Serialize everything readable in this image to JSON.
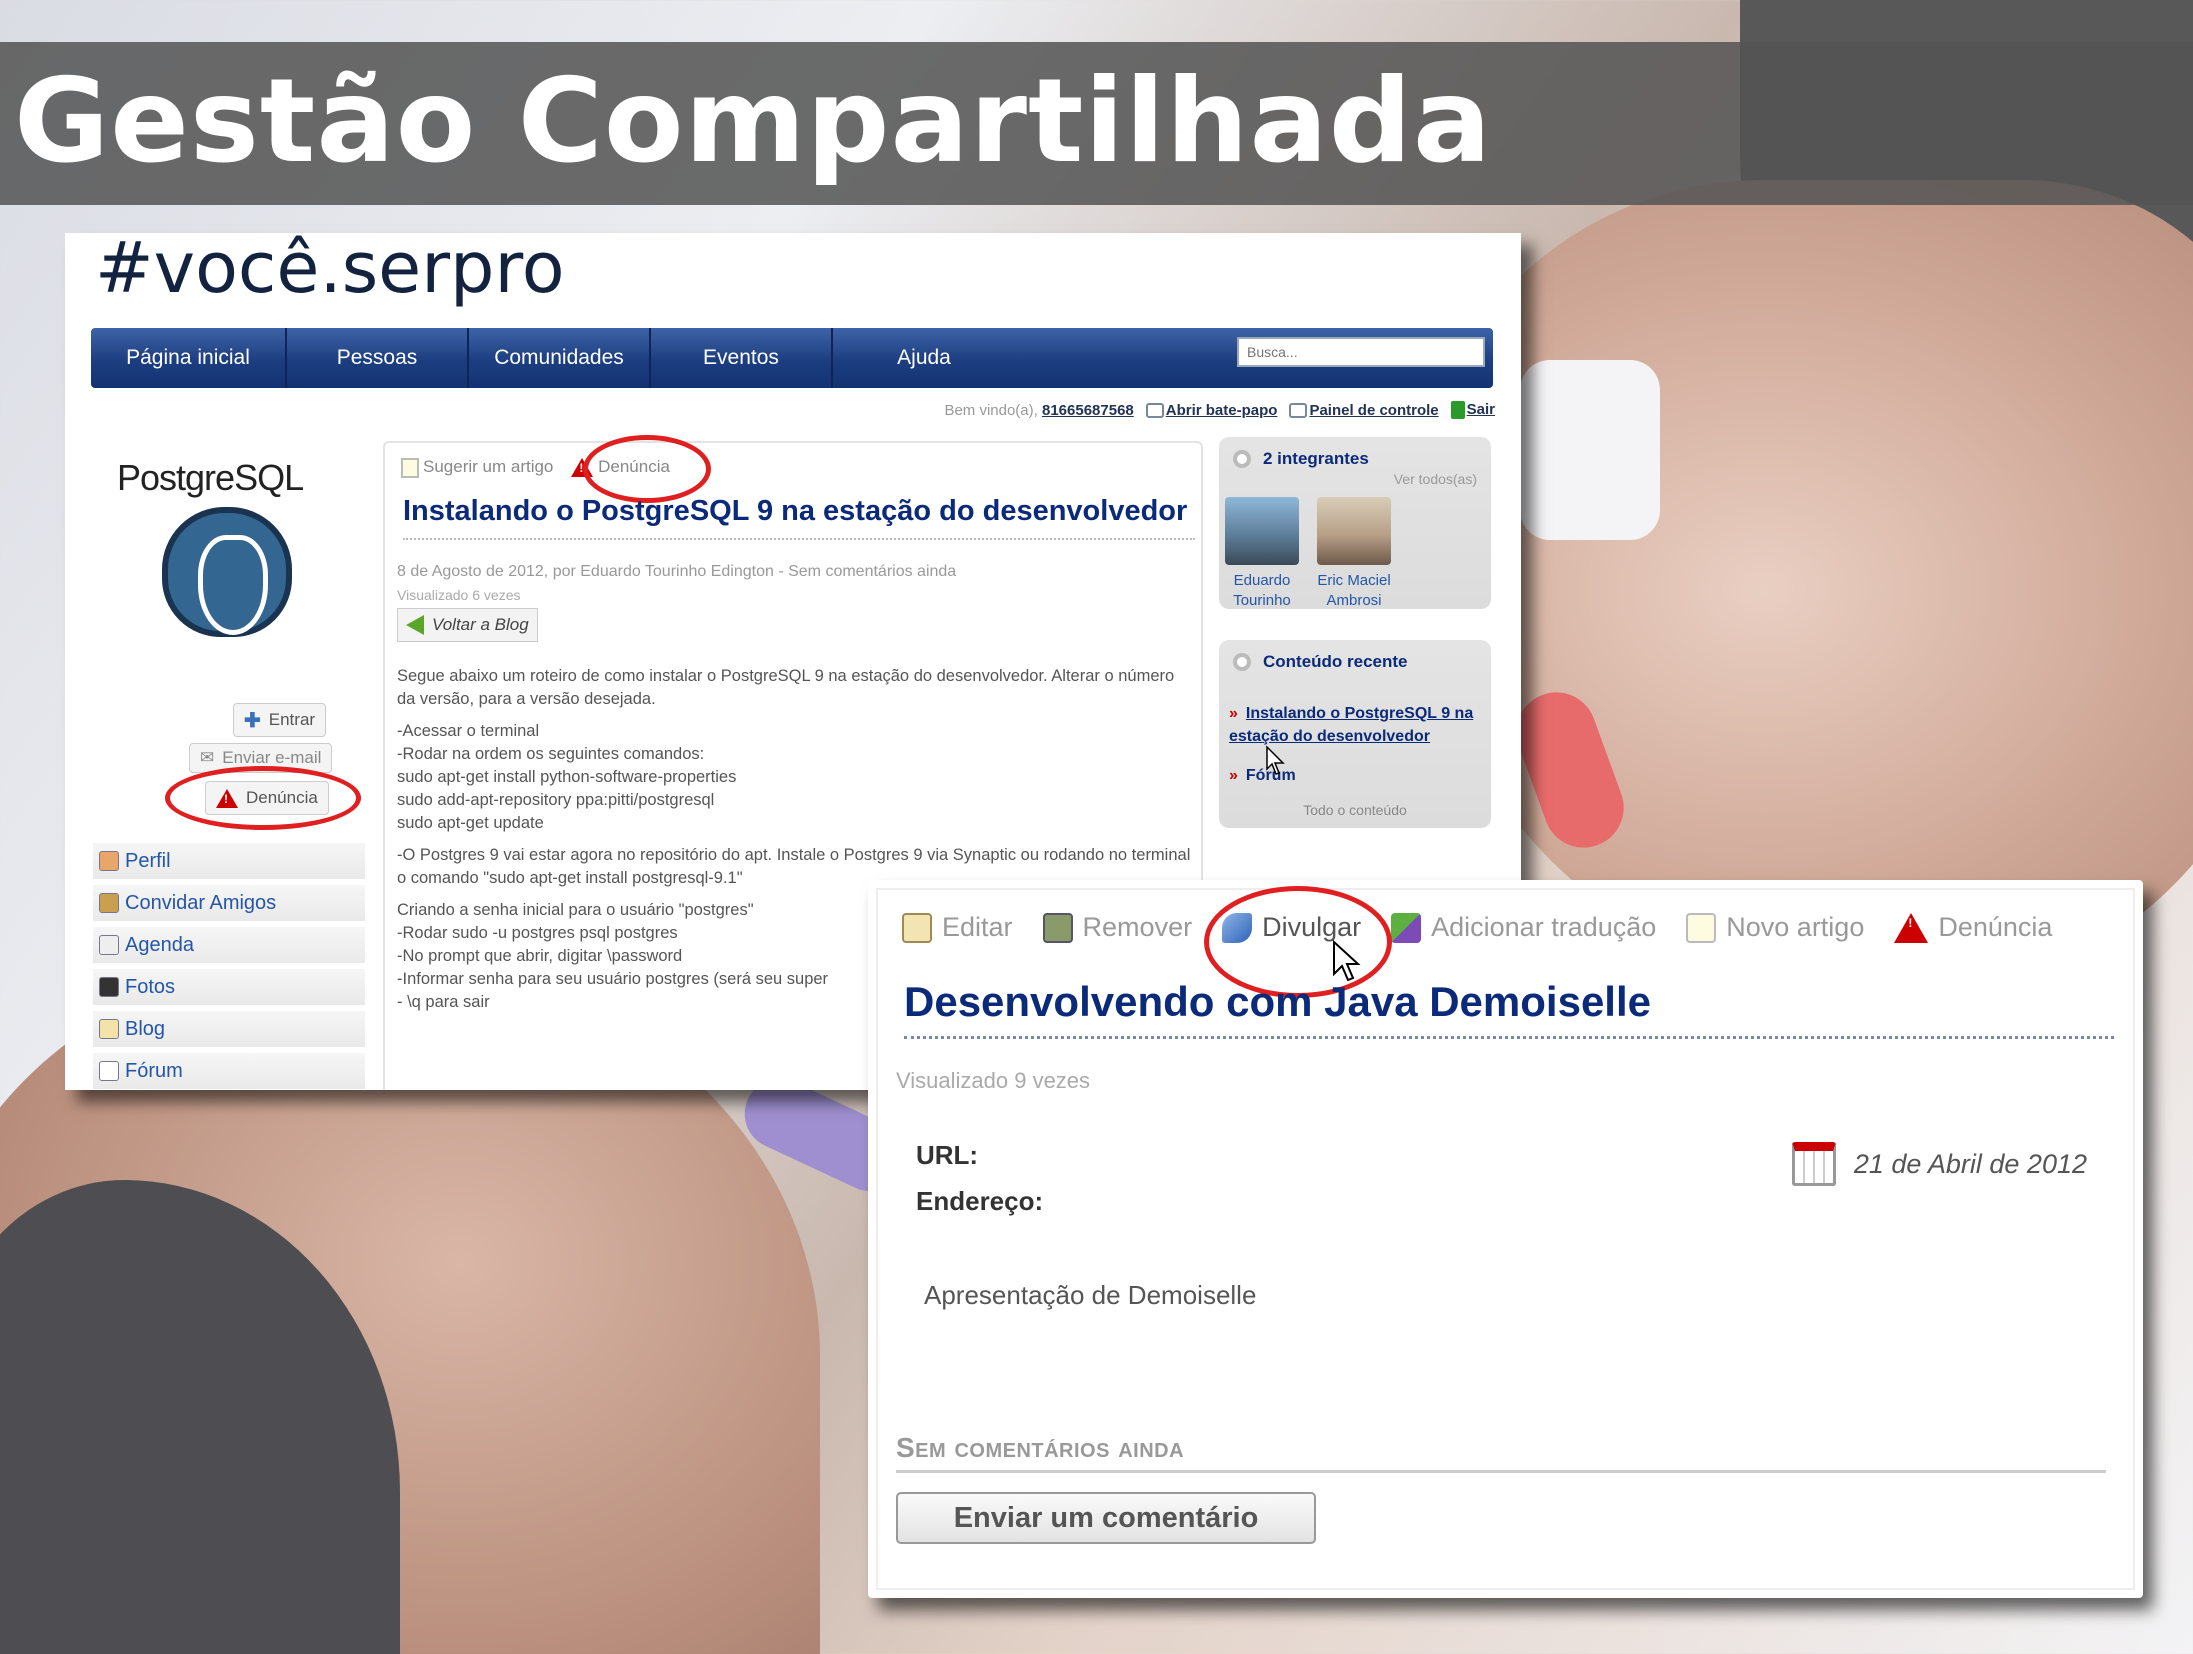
{
  "slide": {
    "title": "Gestão Compartilhada"
  },
  "site": {
    "brand": "#você.serpro",
    "nav": [
      "Página inicial",
      "Pessoas",
      "Comunidades",
      "Eventos",
      "Ajuda"
    ],
    "search_placeholder": "Busca...",
    "userbar": {
      "welcome": "Bem vindo(a),",
      "user": "81665687568",
      "chat": "Abrir bate-papo",
      "panel": "Painel de controle",
      "exit": "Sair"
    }
  },
  "community": {
    "logo_text": "PostgreSQL",
    "buttons": {
      "enter": "Entrar",
      "email": "Enviar e-mail",
      "report": "Denúncia"
    },
    "sidenav": [
      "Perfil",
      "Convidar Amigos",
      "Agenda",
      "Fotos",
      "Blog",
      "Fórum"
    ]
  },
  "article": {
    "actions": {
      "suggest": "Sugerir um artigo",
      "report": "Denúncia"
    },
    "title": "Instalando o PostgreSQL 9 na estação do desenvolvedor",
    "meta": "8 de Agosto de 2012, por Eduardo Tourinho Edington - Sem comentários ainda",
    "views": "Visualizado 6 vezes",
    "back": "Voltar a Blog",
    "body": [
      "Segue abaixo um roteiro de como instalar o PostgreSQL 9 na estação do desenvolvedor. Alterar o número da versão, para a versão desejada.",
      "   -Acessar o terminal\n   -Rodar na ordem os seguintes comandos:\n      sudo apt-get install python-software-properties\n      sudo add-apt-repository ppa:pitti/postgresql\n      sudo apt-get update",
      "   -O Postgres 9 vai estar agora no repositório do apt. Instale o Postgres 9 via Synaptic ou rodando no terminal o comando \"sudo apt-get install postgresql-9.1\"",
      "Criando a senha inicial para o usuário \"postgres\"\n   -Rodar sudo -u postgres psql postgres\n   -No prompt que abrir, digitar \\password\n   -Informar senha para seu usuário postgres (será seu super\n   - \\q para sair"
    ]
  },
  "members_widget": {
    "title": "2 integrantes",
    "see_all": "Ver todos(as)",
    "members": [
      "Eduardo Tourinho",
      "Eric Maciel Ambrosi"
    ]
  },
  "recent_widget": {
    "title": "Conteúdo recente",
    "items": [
      "Instalando o PostgreSQL 9 na estação do desenvolvedor",
      "Fórum"
    ],
    "all": "Todo o conteúdo"
  },
  "event": {
    "actions": [
      "Editar",
      "Remover",
      "Divulgar",
      "Adicionar tradução",
      "Novo artigo",
      "Denúncia"
    ],
    "title": "Desenvolvendo com Java Demoiselle",
    "views": "Visualizado 9 vezes",
    "url_label": "URL:",
    "address_label": "Endereço:",
    "date": "21 de Abril de 2012",
    "description": "Apresentação de Demoiselle",
    "no_comments": "Sem comentários ainda",
    "comment_button": "Enviar um comentário"
  },
  "colors": {
    "nav": "#1c3e80",
    "title_blue": "#0b2b7a",
    "highlight": "#e02020",
    "slide_bar": "#545454"
  }
}
